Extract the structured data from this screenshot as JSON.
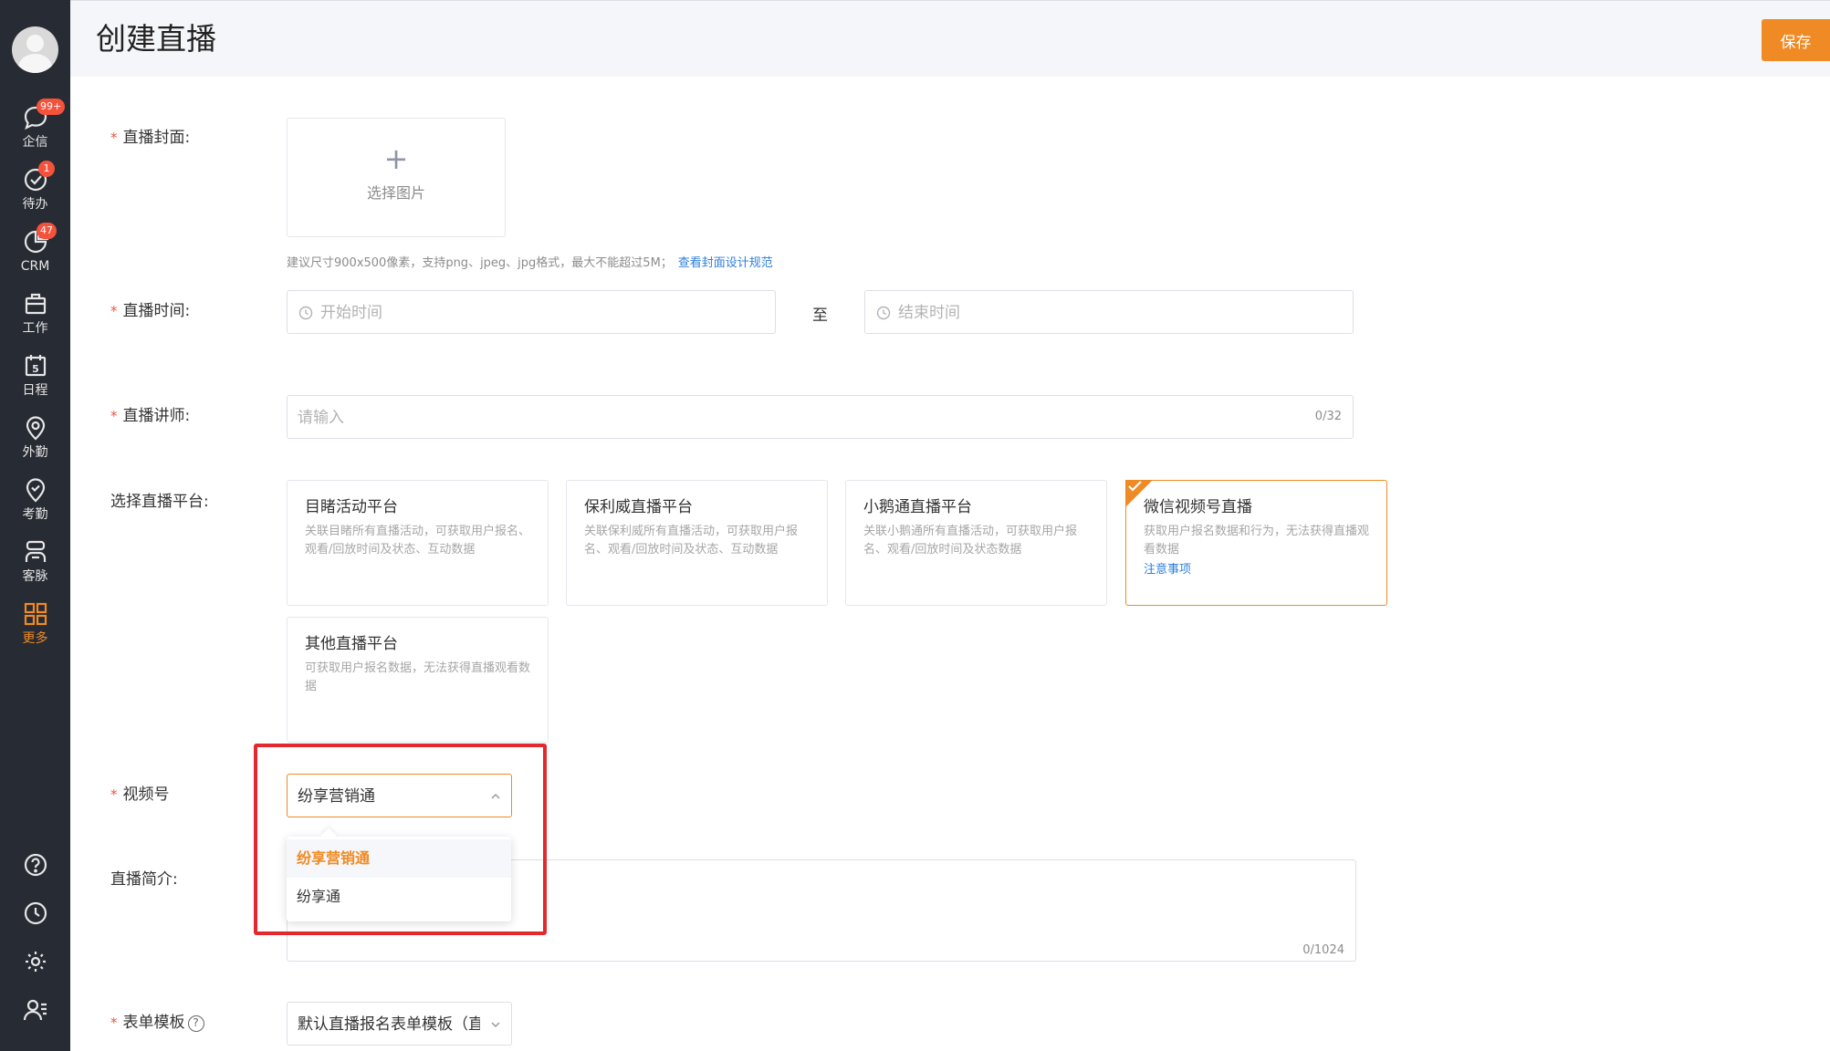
{
  "sidebar": {
    "items": [
      {
        "label": "企信",
        "badge": "99+",
        "icon": "chat-bubble-icon"
      },
      {
        "label": "待办",
        "badge": "1",
        "icon": "check-circle-icon"
      },
      {
        "label": "CRM",
        "badge": "47",
        "icon": "pie-chart-icon"
      },
      {
        "label": "工作",
        "badge": "",
        "icon": "briefcase-icon"
      },
      {
        "label": "日程",
        "badge": "",
        "icon": "calendar-icon",
        "calendar_day": "5"
      },
      {
        "label": "外勤",
        "badge": "",
        "icon": "location-pin-icon"
      },
      {
        "label": "考勤",
        "badge": "",
        "icon": "attendance-check-icon"
      },
      {
        "label": "客脉",
        "badge": "",
        "icon": "contacts-icon"
      },
      {
        "label": "更多",
        "badge": "",
        "icon": "grid-apps-icon",
        "active": true
      }
    ],
    "bottom_icons": [
      "help-icon",
      "history-clock-icon",
      "settings-gear-icon",
      "user-list-icon"
    ]
  },
  "header": {
    "title": "创建直播",
    "save_label": "保存"
  },
  "form": {
    "cover": {
      "label": "直播封面:",
      "upload_text": "选择图片",
      "hint": "建议尺寸900x500像素，支持png、jpeg、jpg格式，最大不能超过5M；",
      "hint_link": "查看封面设计规范"
    },
    "time": {
      "label": "直播时间:",
      "start_placeholder": "开始时间",
      "separator": "至",
      "end_placeholder": "结束时间"
    },
    "lecturer": {
      "label": "直播讲师:",
      "placeholder": "请输入",
      "counter": "0/32"
    },
    "platform": {
      "label": "选择直播平台:",
      "options": [
        {
          "title": "目睹活动平台",
          "desc": "关联目睹所有直播活动，可获取用户报名、观看/回放时间及状态、互动数据",
          "link": "",
          "selected": false
        },
        {
          "title": "保利威直播平台",
          "desc": "关联保利威所有直播活动，可获取用户报名、观看/回放时间及状态、互动数据",
          "link": "",
          "selected": false
        },
        {
          "title": "小鹅通直播平台",
          "desc": "关联小鹅通所有直播活动，可获取用户报名、观看/回放时间及状态数据",
          "link": "",
          "selected": false
        },
        {
          "title": "微信视频号直播",
          "desc": "获取用户报名数据和行为，无法获得直播观看数据",
          "link": "注意事项",
          "selected": true
        },
        {
          "title": "其他直播平台",
          "desc": "可获取用户报名数据，无法获得直播观看数据",
          "link": "",
          "selected": false
        }
      ]
    },
    "channel": {
      "label": "视频号",
      "value": "纷享营销通",
      "dropdown_options": [
        {
          "label": "纷享营销通",
          "active": true
        },
        {
          "label": "纷享通",
          "active": false
        }
      ]
    },
    "intro": {
      "label": "直播简介:",
      "counter": "0/1024"
    },
    "form_template": {
      "label": "表单模板",
      "value": "默认直播报名表单模板（直"
    }
  },
  "colors": {
    "accent": "#f08a24",
    "sidebar_bg": "#272b33",
    "badge": "#f4523b",
    "link": "#2f7fd9",
    "highlight": "#e3282e"
  }
}
